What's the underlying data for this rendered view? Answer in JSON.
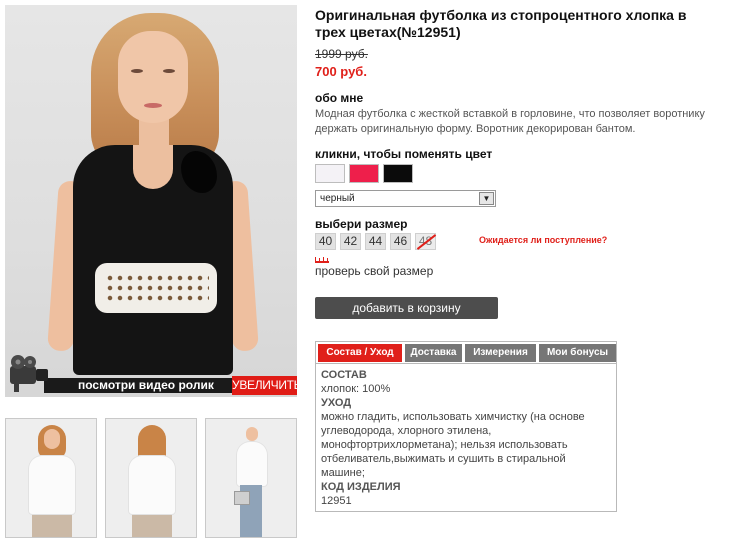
{
  "product": {
    "title": "Оригинальная футболка из стопроцентного хлопка в трех цветах(№12951)",
    "old_price": "1999 руб.",
    "new_price": "700 руб."
  },
  "about": {
    "heading": "обо мне",
    "text": "Модная футболка с жесткой вставкой в горловине, что позволяет воротнику держать оригинальную форму. Воротник декорирован бантом."
  },
  "color": {
    "heading": "кликни, чтобы поменять цвет",
    "swatches": [
      {
        "name": "white",
        "color": "#f4f2f6"
      },
      {
        "name": "pink",
        "color": "#ee1f4b"
      },
      {
        "name": "black",
        "color": "#0b0b0b"
      }
    ],
    "selected": "черный"
  },
  "size": {
    "heading": "выбери размер",
    "options": [
      "40",
      "42",
      "44",
      "46",
      "48"
    ],
    "sold_out": [
      "48"
    ],
    "notify_link": "Ожидается ли поступление?",
    "check_link": "проверь свой размер"
  },
  "cart": {
    "label": "добавить в корзину"
  },
  "media": {
    "video_label": "посмотри видео ролик",
    "zoom_label": "УВЕЛИЧИТЬ"
  },
  "tabs": {
    "items": [
      "Состав / Уход",
      "Доставка",
      "Измерения",
      "Мои бонусы"
    ],
    "active": "Состав / Уход",
    "content": {
      "composition_heading": "СОСТАВ",
      "composition": "хлопок: 100%",
      "care_heading": "УХОД",
      "care_lines": [
        "можно гладить, использовать химчистку (на основе",
        "углеводорода, хлорного этилена,",
        "монофтортрихлорметана); нельзя использовать",
        "отбеливатель,выжимать и сушить в стиральной",
        "машине;"
      ],
      "code_heading": "КОД ИЗДЕЛИЯ",
      "code": "12951"
    }
  },
  "colors": {
    "accent": "#e0201a",
    "button": "#4d4d4d",
    "tab": "#767676"
  }
}
